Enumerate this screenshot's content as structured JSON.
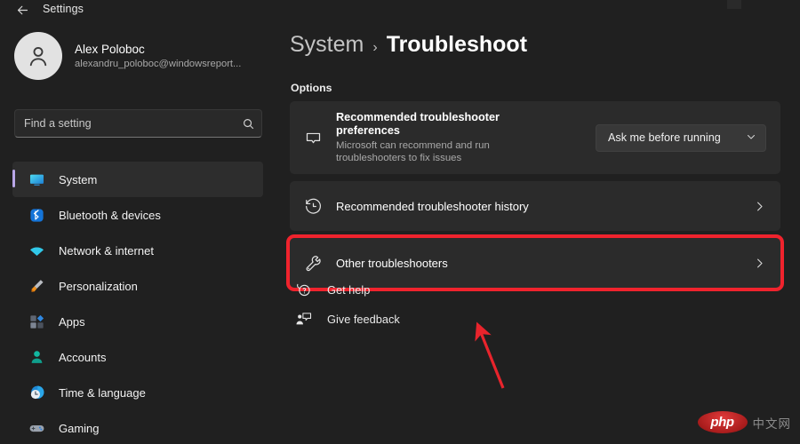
{
  "window": {
    "title": "Settings",
    "back_icon": "back-arrow-icon",
    "bg_color": "#202020",
    "card_color": "#2b2b2b"
  },
  "sidebar": {
    "profile": {
      "name": "Alex Poloboc",
      "email": "alexandru_poloboc@windowsreport...",
      "avatar_icon": "person-avatar-icon"
    },
    "search": {
      "placeholder": "Find a setting",
      "value": "",
      "icon": "search-icon"
    },
    "items": [
      {
        "label": "System",
        "icon": "monitor-icon",
        "selected": true
      },
      {
        "label": "Bluetooth & devices",
        "icon": "bluetooth-icon",
        "selected": false
      },
      {
        "label": "Network & internet",
        "icon": "wifi-icon",
        "selected": false
      },
      {
        "label": "Personalization",
        "icon": "paintbrush-icon",
        "selected": false
      },
      {
        "label": "Apps",
        "icon": "apps-grid-icon",
        "selected": false
      },
      {
        "label": "Accounts",
        "icon": "person-icon",
        "selected": false
      },
      {
        "label": "Time & language",
        "icon": "clock-globe-icon",
        "selected": false
      },
      {
        "label": "Gaming",
        "icon": "gamepad-icon",
        "selected": false
      }
    ],
    "selection_indicator_color": "#b9a7e8"
  },
  "main": {
    "breadcrumb": {
      "parent": "System",
      "separator": "›",
      "current": "Troubleshoot"
    },
    "section_label": "Options",
    "cards": [
      {
        "title": "Recommended troubleshooter preferences",
        "description": "Microsoft can recommend and run troubleshooters to fix issues",
        "icon": "speech-bubble-icon",
        "control": "dropdown",
        "dropdown_value": "Ask me before running",
        "dropdown_chevron": "chevron-down-icon"
      },
      {
        "title": "Recommended troubleshooter history",
        "description": "",
        "icon": "history-clock-icon",
        "control": "chevron",
        "chevron": "chevron-right-icon"
      },
      {
        "title": "Other troubleshooters",
        "description": "",
        "icon": "wrench-icon",
        "control": "chevron",
        "chevron": "chevron-right-icon",
        "highlighted": true
      }
    ],
    "footer_links": [
      {
        "label": "Get help",
        "icon": "help-question-bubble-icon"
      },
      {
        "label": "Give feedback",
        "icon": "feedback-person-bubble-icon"
      }
    ]
  },
  "annotations": {
    "highlight_color": "#f0232d",
    "arrow_color": "#e8242c",
    "arrow_target": "Other troubleshooters"
  },
  "watermark": {
    "badge_text": "php",
    "suffix_text": "中文网"
  }
}
